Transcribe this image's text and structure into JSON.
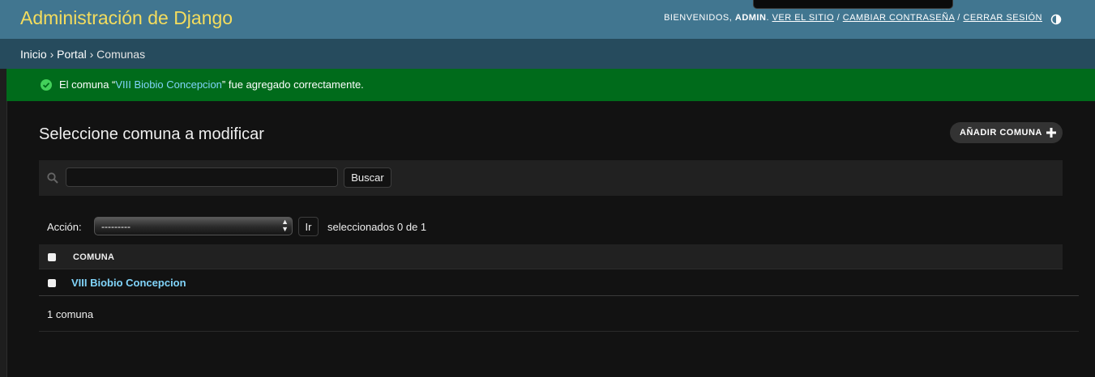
{
  "header": {
    "branding": "Administración de Django",
    "welcome": "Bienvenidos,",
    "username": "admin",
    "view_site": "Ver el sitio",
    "change_password": "Cambiar contraseña",
    "logout": "Cerrar sesión",
    "separator": "/",
    "theme_icon": "half-circle-theme-icon"
  },
  "breadcrumbs": {
    "home": "Inicio",
    "app": "Portal",
    "current": "Comunas",
    "separator": "›"
  },
  "message": {
    "prefix": "El comuna “",
    "link": "VIII Biobio Concepcion",
    "suffix": "” fue agregado correctamente.",
    "icon": "success-check-icon"
  },
  "content": {
    "title": "Seleccione comuna a modificar",
    "add_button": "Añadir comuna"
  },
  "search": {
    "value": "",
    "button": "Buscar"
  },
  "actions": {
    "label": "Acción:",
    "selected": "---------",
    "go": "Ir",
    "counter": "seleccionados 0 de 1"
  },
  "table": {
    "column": "Comuna",
    "rows": [
      {
        "name": "VIII Biobio Concepcion"
      }
    ]
  },
  "paginator": {
    "text": "1 comuna"
  },
  "colors": {
    "header": "#417690",
    "branding": "#f5dd5d",
    "breadcrumbs": "#264b5d",
    "success": "#006b1b",
    "link": "#81d4fa",
    "background": "#121212"
  }
}
